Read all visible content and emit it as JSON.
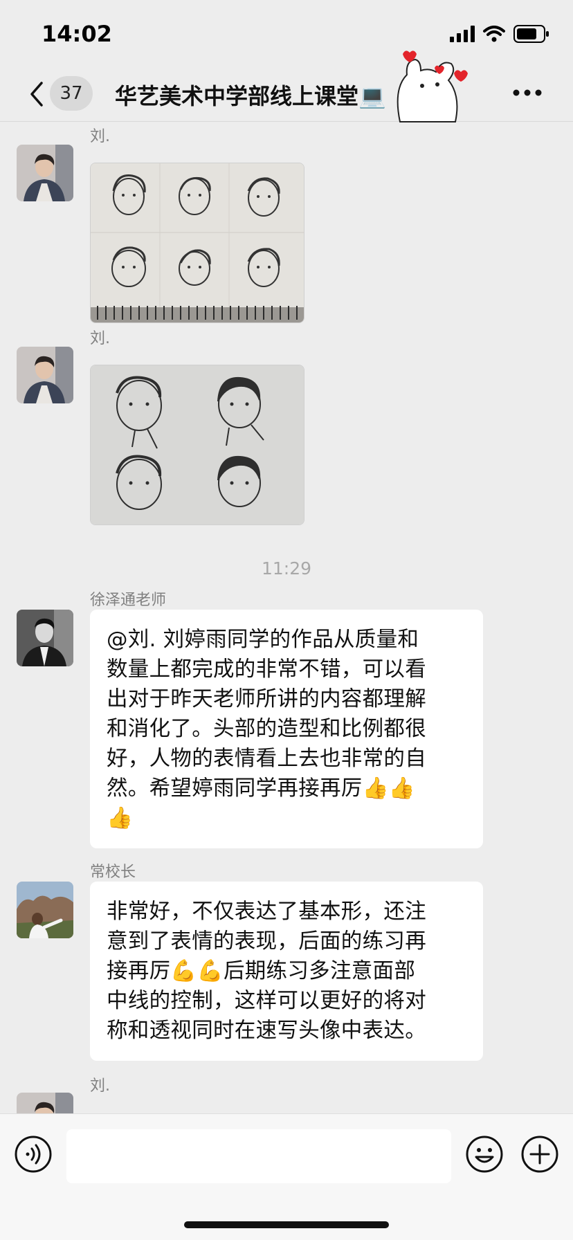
{
  "status_bar": {
    "time": "14:02"
  },
  "header": {
    "unread_count": "37",
    "title": "华艺美术中学部线上课堂"
  },
  "messages": [
    {
      "sender": "刘.",
      "type": "image",
      "alt_icon": "sketch-photo"
    },
    {
      "sender": "刘.",
      "type": "image",
      "alt_icon": "sketch-photo"
    },
    {
      "timestamp": "11:29"
    },
    {
      "sender": "徐泽通老师",
      "type": "text",
      "lines": [
        "@刘. 刘婷雨同学的作品从质量和",
        "数量上都完成的非常不错，可以看",
        "出对于昨天老师所讲的内容都理解",
        "和消化了。头部的造型和比例都很",
        "好，人物的表情看上去也非常的自",
        "然。希望婷雨同学再接再厉👍👍",
        "👍"
      ]
    },
    {
      "sender": "常校长",
      "type": "text",
      "lines": [
        "非常好，不仅表达了基本形，还注",
        "意到了表情的表现，后面的练习再",
        "接再厉💪💪后期练习多注意面部",
        "中线的控制，这样可以更好的将对",
        "称和透视同时在速写头像中表达。"
      ]
    },
    {
      "sender": "刘.",
      "type": "partial"
    }
  ],
  "colors": {
    "background": "#ededed",
    "bubble": "#ffffff",
    "sender_name": "#808080"
  }
}
